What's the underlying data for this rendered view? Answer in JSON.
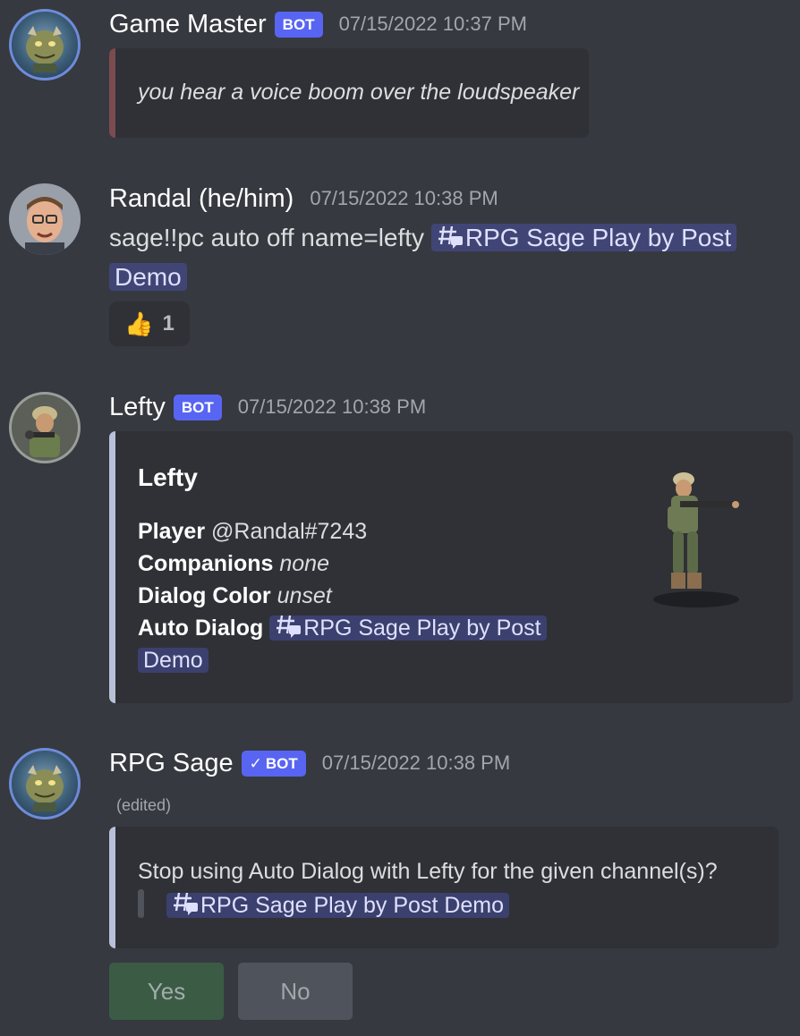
{
  "messages": {
    "gm": {
      "username": "Game Master",
      "bot_tag": "BOT",
      "timestamp": "07/15/2022 10:37 PM",
      "embed_text": "you hear a voice boom over the loudspeaker"
    },
    "randal": {
      "username": "Randal (he/him)",
      "timestamp": "07/15/2022 10:38 PM",
      "content": "sage!!pc auto off name=lefty",
      "channel_mention_line1": "RPG Sage Play by Post",
      "channel_mention_line2": "Demo",
      "reaction_emoji": "👍",
      "reaction_count": "1"
    },
    "lefty": {
      "username": "Lefty",
      "bot_tag": "BOT",
      "timestamp": "07/15/2022 10:38 PM",
      "embed_title": "Lefty",
      "player_label": "Player",
      "player_value": "@Randal#7243",
      "companions_label": "Companions",
      "companions_value": "none",
      "dialog_color_label": "Dialog Color",
      "dialog_color_value": "unset",
      "auto_dialog_label": "Auto Dialog",
      "auto_dialog_line1": "RPG Sage Play by Post",
      "auto_dialog_line2": "Demo"
    },
    "sage": {
      "username": "RPG Sage",
      "bot_tag": "BOT",
      "verified_check": "✓",
      "timestamp": "07/15/2022 10:38 PM",
      "edited": "(edited)",
      "embed_text": "Stop using Auto Dialog with Lefty for the given channel(s)?",
      "channel_mention": "RPG Sage Play by Post Demo",
      "yes_label": "Yes",
      "no_label": "No"
    }
  },
  "colors": {
    "background": "#36393f",
    "embed_bg": "#2f3136",
    "bot_tag": "#5865f2",
    "gm_embed_border": "#7a4b4f",
    "lefty_embed_border": "#b9c1d9",
    "sage_embed_border": "#b9c1d9",
    "yes_button": "#3b5b45",
    "no_button": "#4f545c"
  },
  "icons": {
    "channel": "text-channel-thread-icon",
    "reaction": "thumbs-up-emoji"
  }
}
